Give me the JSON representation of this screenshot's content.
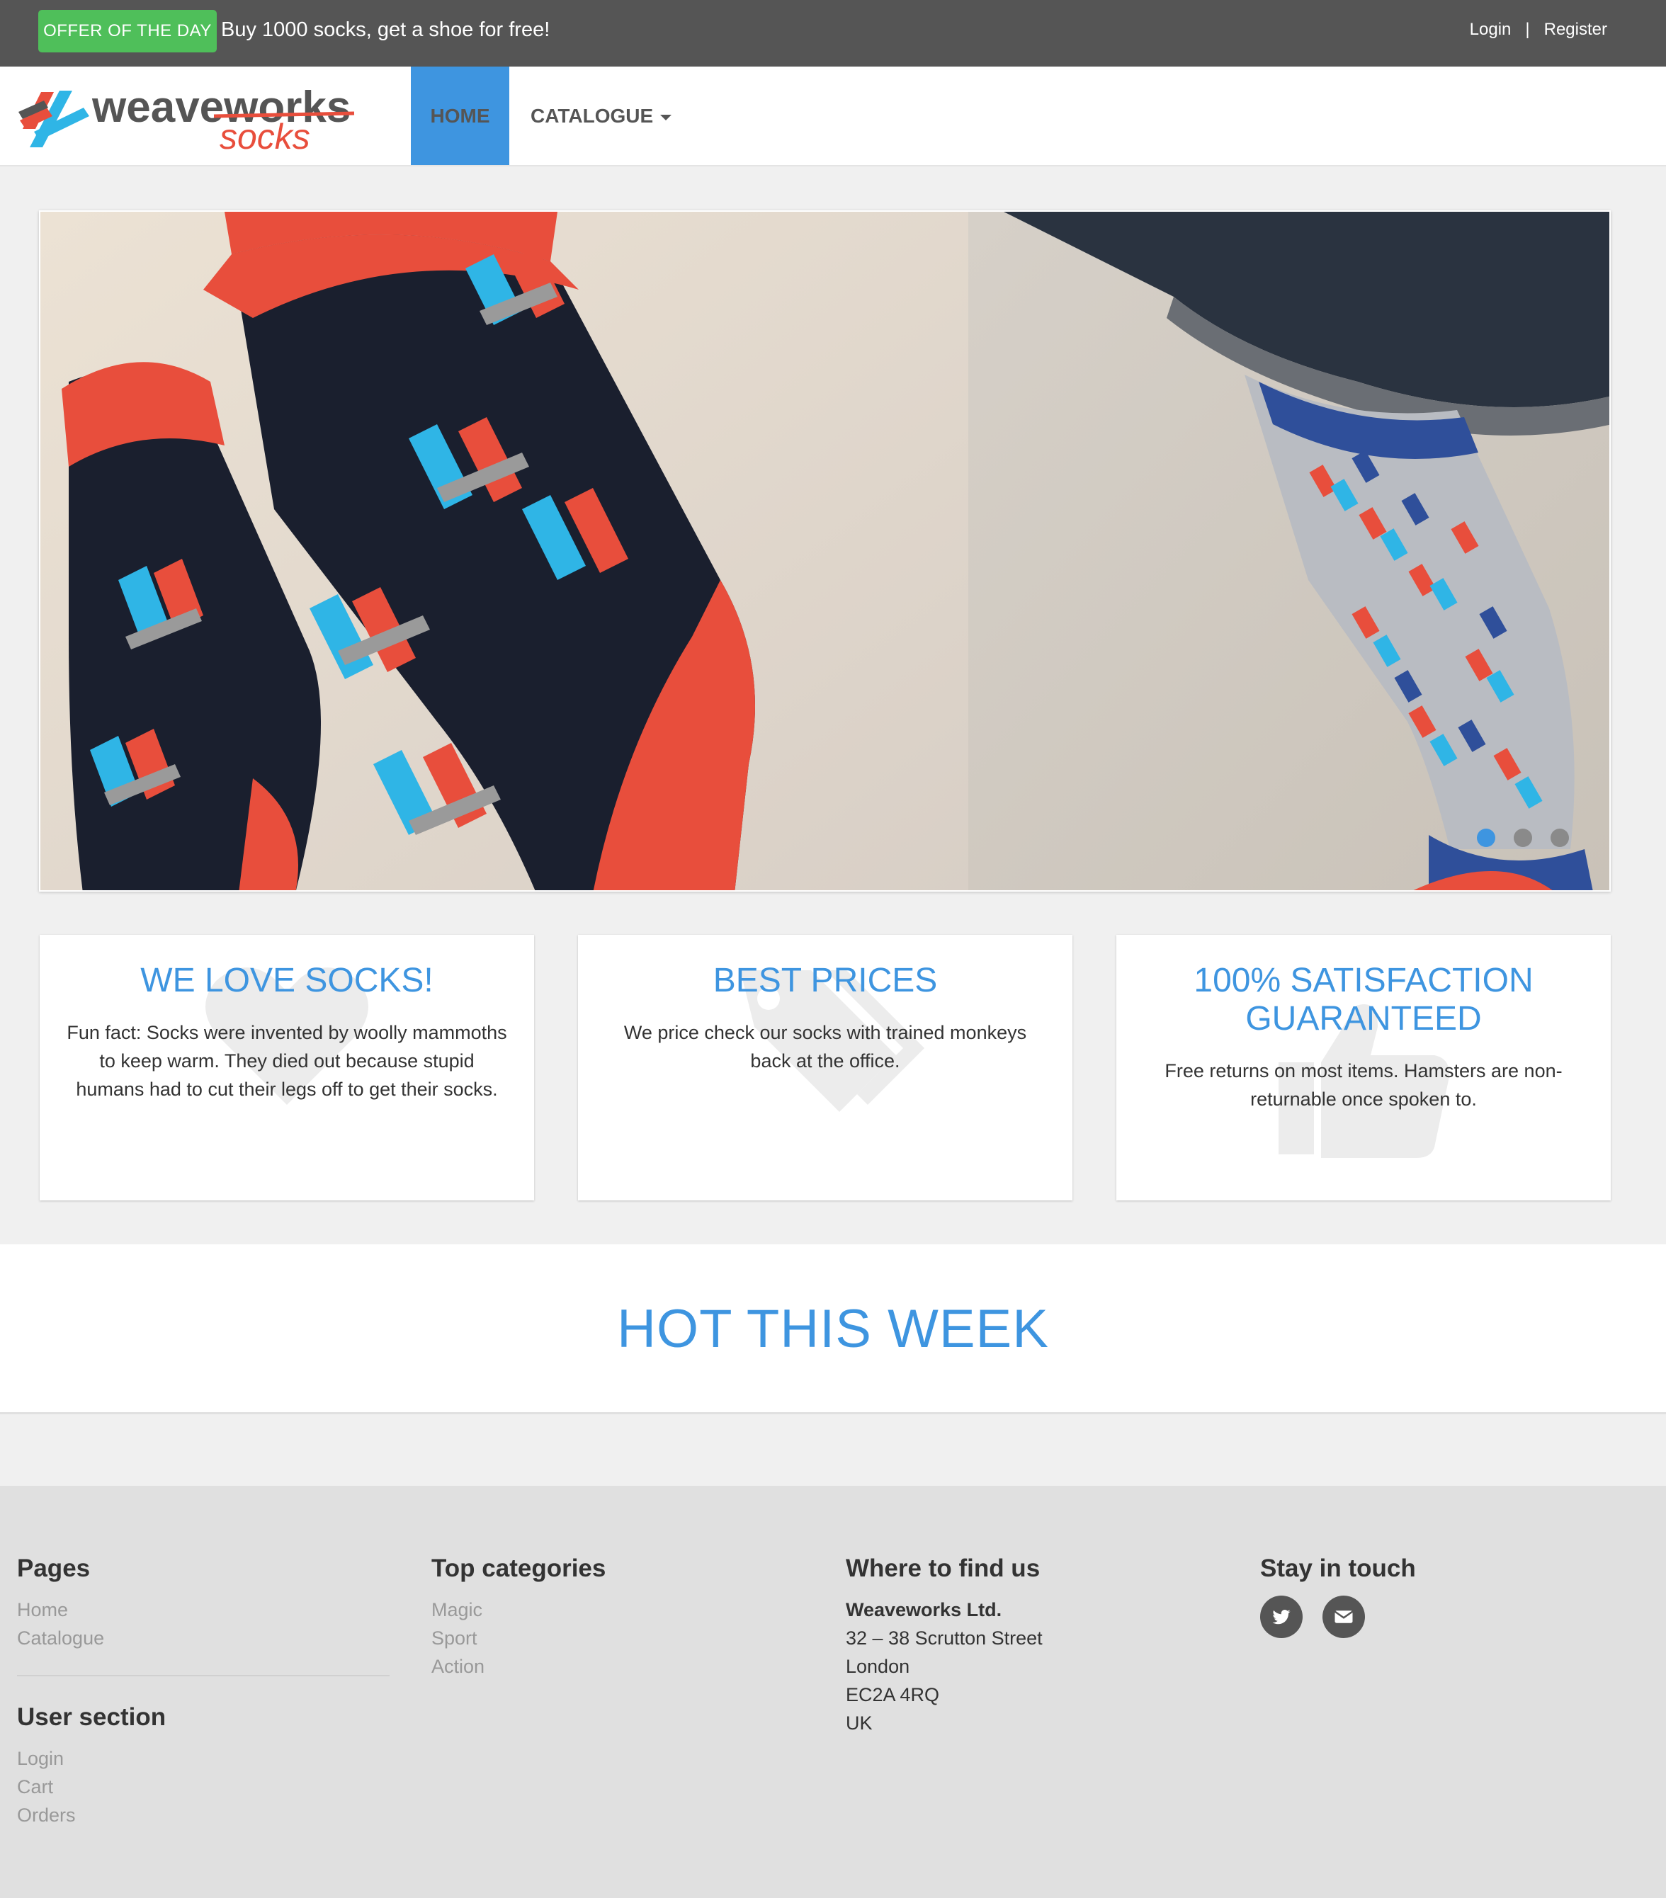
{
  "topbar": {
    "offer_badge": "OFFER OF THE DAY",
    "offer_text": "Buy 1000 socks, get a shoe for free!",
    "login": "Login",
    "separator": "|",
    "register": "Register"
  },
  "brand": {
    "logo_word": "weaveworks",
    "logo_sub": "socks"
  },
  "nav": {
    "home": "HOME",
    "catalogue": "CATALOGUE"
  },
  "carousel": {
    "slide_count": 3,
    "active_index": 0,
    "colors": {
      "active_dot": "#3e95e0",
      "dot": "#8a8a8a"
    }
  },
  "features": [
    {
      "icon": "heart-icon",
      "title": "WE LOVE SOCKS!",
      "text": "Fun fact: Socks were invented by woolly mammoths to keep warm. They died out because stupid humans had to cut their legs off to get their socks."
    },
    {
      "icon": "price-tags-icon",
      "title": "BEST PRICES",
      "text": "We price check our socks with trained monkeys back at the office."
    },
    {
      "icon": "thumbs-up-icon",
      "title": "100% SATISFACTION GUARANTEED",
      "text": "Free returns on most items. Hamsters are non-returnable once spoken to."
    }
  ],
  "hot": {
    "title": "HOT THIS WEEK"
  },
  "footer": {
    "pages": {
      "title": "Pages",
      "links": [
        "Home",
        "Catalogue"
      ]
    },
    "user_section": {
      "title": "User section",
      "links": [
        "Login",
        "Cart",
        "Orders"
      ]
    },
    "categories": {
      "title": "Top categories",
      "links": [
        "Magic",
        "Sport",
        "Action"
      ]
    },
    "location": {
      "title": "Where to find us",
      "company": "Weaveworks Ltd.",
      "lines": [
        "32 – 38 Scrutton Street",
        "London",
        "EC2A 4RQ",
        "UK"
      ]
    },
    "social": {
      "title": "Stay in touch",
      "icons": [
        "twitter-icon",
        "envelope-icon"
      ]
    }
  },
  "colors": {
    "accent": "#3e95e0",
    "offer_green": "#4fbf5a",
    "topbar": "#555555"
  }
}
